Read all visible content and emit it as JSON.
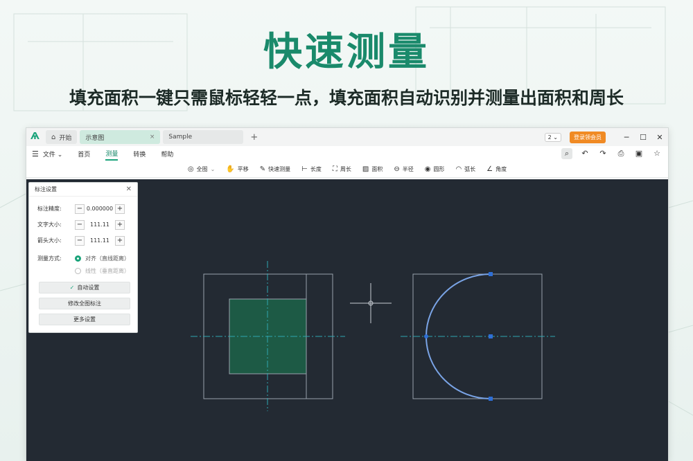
{
  "hero": {
    "title": "快速测量",
    "subtitle": "填充面积一键只需鼠标轻轻一点，填充面积自动识别并测量出面积和周长"
  },
  "titlebar": {
    "tabs": [
      {
        "label": "开始"
      },
      {
        "label": "示意图"
      },
      {
        "label": "Sample"
      }
    ],
    "page_select": "2",
    "vip_button": "登录领会员"
  },
  "menubar": {
    "items": [
      "文件",
      "首页",
      "测量",
      "转换",
      "帮助"
    ],
    "active": "测量"
  },
  "toolbar": {
    "items": [
      {
        "icon": "fit-all-icon",
        "label": "全图"
      },
      {
        "icon": "hand-icon",
        "label": "平移"
      },
      {
        "icon": "quick-measure-icon",
        "label": "快速测量"
      },
      {
        "icon": "length-icon",
        "label": "长度"
      },
      {
        "icon": "perimeter-icon",
        "label": "周长"
      },
      {
        "icon": "area-icon",
        "label": "面积"
      },
      {
        "icon": "radius-icon",
        "label": "半径"
      },
      {
        "icon": "circle-icon",
        "label": "圆形"
      },
      {
        "icon": "arc-icon",
        "label": "弧长"
      },
      {
        "icon": "angle-icon",
        "label": "角度"
      }
    ]
  },
  "panel": {
    "title": "标注设置",
    "rows": [
      {
        "label": "标注精度:",
        "value": "0.000000"
      },
      {
        "label": "文字大小:",
        "value": "111.11"
      },
      {
        "label": "箭头大小:",
        "value": "111.11"
      }
    ],
    "method_label": "测量方式:",
    "method_options": [
      {
        "label": "对齐（直线距离）",
        "selected": true
      },
      {
        "label": "线性（垂直距离）",
        "selected": false
      }
    ],
    "buttons": {
      "auto": "自动设置",
      "modify": "修改全图标注",
      "more": "更多设置"
    }
  },
  "colors": {
    "accent": "#1aa37a",
    "canvas": "#232a33",
    "fill": "#1d5a45",
    "vip": "#f08a24"
  }
}
